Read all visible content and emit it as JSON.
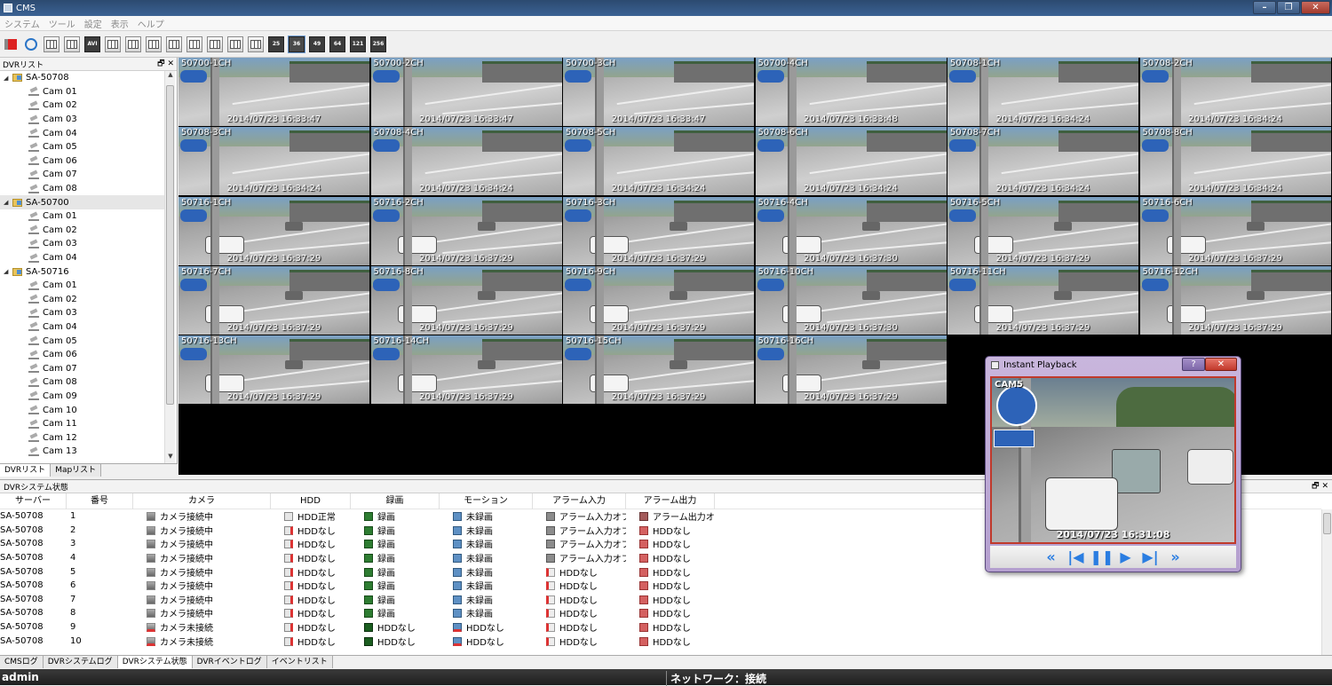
{
  "window": {
    "title": "CMS"
  },
  "menu": [
    "システム",
    "ツール",
    "設定",
    "表示",
    "ヘルプ"
  ],
  "toolbar": {
    "layout_labels": [
      "25",
      "36",
      "49",
      "64",
      "121",
      "256"
    ],
    "avi_label": "AVI"
  },
  "dvr_list": {
    "title": "DVRリスト",
    "groups": [
      {
        "name": "SA-50708",
        "cams": [
          "Cam 01",
          "Cam 02",
          "Cam 03",
          "Cam 04",
          "Cam 05",
          "Cam 06",
          "Cam 07",
          "Cam 08"
        ]
      },
      {
        "name": "SA-50700",
        "cams": [
          "Cam 01",
          "Cam 02",
          "Cam 03",
          "Cam 04"
        ]
      },
      {
        "name": "SA-50716",
        "cams": [
          "Cam 01",
          "Cam 02",
          "Cam 03",
          "Cam 04",
          "Cam 05",
          "Cam 06",
          "Cam 07",
          "Cam 08",
          "Cam 09",
          "Cam 10",
          "Cam 11",
          "Cam 12",
          "Cam 13"
        ]
      }
    ],
    "tabs": [
      "DVRリスト",
      "Mapリスト"
    ]
  },
  "video_cells": [
    {
      "label": "50700-1CH",
      "time": "2014/07/23 16:33:47"
    },
    {
      "label": "50700-2CH",
      "time": "2014/07/23 16:33:47"
    },
    {
      "label": "50700-3CH",
      "time": "2014/07/23 16:33:47"
    },
    {
      "label": "50700-4CH",
      "time": "2014/07/23 16:33:48"
    },
    {
      "label": "50708-1CH",
      "time": "2014/07/23 16:34:24"
    },
    {
      "label": "50708-2CH",
      "time": "2014/07/23 16:34:24"
    },
    {
      "label": "50708-3CH",
      "time": "2014/07/23 16:34:24"
    },
    {
      "label": "50708-4CH",
      "time": "2014/07/23 16:34:24"
    },
    {
      "label": "50708-5CH",
      "time": "2014/07/23 16:34:24"
    },
    {
      "label": "50708-6CH",
      "time": "2014/07/23 16:34:24"
    },
    {
      "label": "50708-7CH",
      "time": "2014/07/23 16:34:24"
    },
    {
      "label": "50708-8CH",
      "time": "2014/07/23 16:34:24"
    },
    {
      "label": "50716-1CH",
      "time": "2014/07/23 16:37:29"
    },
    {
      "label": "50716-2CH",
      "time": "2014/07/23 16:37:29"
    },
    {
      "label": "50716-3CH",
      "time": "2014/07/23 16:37:29"
    },
    {
      "label": "50716-4CH",
      "time": "2014/07/23 16:37:30"
    },
    {
      "label": "50716-5CH",
      "time": "2014/07/23 16:37:29"
    },
    {
      "label": "50716-6CH",
      "time": "2014/07/23 16:37:29"
    },
    {
      "label": "50716-7CH",
      "time": "2014/07/23 16:37:29"
    },
    {
      "label": "50716-8CH",
      "time": "2014/07/23 16:37:29"
    },
    {
      "label": "50716-9CH",
      "time": "2014/07/23 16:37:29"
    },
    {
      "label": "50716-10CH",
      "time": "2014/07/23 16:37:30"
    },
    {
      "label": "50716-11CH",
      "time": "2014/07/23 16:37:29"
    },
    {
      "label": "50716-12CH",
      "time": "2014/07/23 16:37:29"
    },
    {
      "label": "50716-13CH",
      "time": "2014/07/23 16:37:29"
    },
    {
      "label": "50716-14CH",
      "time": "2014/07/23 16:37:29"
    },
    {
      "label": "50716-15CH",
      "time": "2014/07/23 16:37:29"
    },
    {
      "label": "50716-16CH",
      "time": "2014/07/23 16:37:29"
    }
  ],
  "status_panel": {
    "title": "DVRシステム状態",
    "columns": [
      "サーバー",
      "番号",
      "カメラ",
      "HDD",
      "録画",
      "モーション",
      "アラーム入力",
      "アラーム出力"
    ],
    "rows": [
      {
        "server": "SA-50708",
        "no": "1",
        "cam": "カメラ接続中",
        "cam_s": "on",
        "hdd": "HDD正常",
        "hdd_s": "ok",
        "rec": "録画",
        "rec_s": "rec",
        "mot": "未録画",
        "mot_s": "mot",
        "ai": "アラーム入力オフ",
        "ai_s": "off",
        "ao": "アラーム出力オフ",
        "ao_s": "off"
      },
      {
        "server": "SA-50708",
        "no": "2",
        "cam": "カメラ接続中",
        "cam_s": "on",
        "hdd": "HDDなし",
        "hdd_s": "none",
        "rec": "録画",
        "rec_s": "rec",
        "mot": "未録画",
        "mot_s": "mot",
        "ai": "アラーム入力オフ",
        "ai_s": "off",
        "ao": "HDDなし",
        "ao_s": "none"
      },
      {
        "server": "SA-50708",
        "no": "3",
        "cam": "カメラ接続中",
        "cam_s": "on",
        "hdd": "HDDなし",
        "hdd_s": "none",
        "rec": "録画",
        "rec_s": "rec",
        "mot": "未録画",
        "mot_s": "mot",
        "ai": "アラーム入力オフ",
        "ai_s": "off",
        "ao": "HDDなし",
        "ao_s": "none"
      },
      {
        "server": "SA-50708",
        "no": "4",
        "cam": "カメラ接続中",
        "cam_s": "on",
        "hdd": "HDDなし",
        "hdd_s": "none",
        "rec": "録画",
        "rec_s": "rec",
        "mot": "未録画",
        "mot_s": "mot",
        "ai": "アラーム入力オフ",
        "ai_s": "off",
        "ao": "HDDなし",
        "ao_s": "none"
      },
      {
        "server": "SA-50708",
        "no": "5",
        "cam": "カメラ接続中",
        "cam_s": "on",
        "hdd": "HDDなし",
        "hdd_s": "none",
        "rec": "録画",
        "rec_s": "rec",
        "mot": "未録画",
        "mot_s": "mot",
        "ai": "HDDなし",
        "ai_s": "none",
        "ao": "HDDなし",
        "ao_s": "none"
      },
      {
        "server": "SA-50708",
        "no": "6",
        "cam": "カメラ接続中",
        "cam_s": "on",
        "hdd": "HDDなし",
        "hdd_s": "none",
        "rec": "録画",
        "rec_s": "rec",
        "mot": "未録画",
        "mot_s": "mot",
        "ai": "HDDなし",
        "ai_s": "none",
        "ao": "HDDなし",
        "ao_s": "none"
      },
      {
        "server": "SA-50708",
        "no": "7",
        "cam": "カメラ接続中",
        "cam_s": "on",
        "hdd": "HDDなし",
        "hdd_s": "none",
        "rec": "録画",
        "rec_s": "rec",
        "mot": "未録画",
        "mot_s": "mot",
        "ai": "HDDなし",
        "ai_s": "none",
        "ao": "HDDなし",
        "ao_s": "none"
      },
      {
        "server": "SA-50708",
        "no": "8",
        "cam": "カメラ接続中",
        "cam_s": "on",
        "hdd": "HDDなし",
        "hdd_s": "none",
        "rec": "録画",
        "rec_s": "rec",
        "mot": "未録画",
        "mot_s": "mot",
        "ai": "HDDなし",
        "ai_s": "none",
        "ao": "HDDなし",
        "ao_s": "none"
      },
      {
        "server": "SA-50708",
        "no": "9",
        "cam": "カメラ未接続",
        "cam_s": "off",
        "hdd": "HDDなし",
        "hdd_s": "none",
        "rec": "HDDなし",
        "rec_s": "none",
        "mot": "HDDなし",
        "mot_s": "none",
        "ai": "HDDなし",
        "ai_s": "none",
        "ao": "HDDなし",
        "ao_s": "none"
      },
      {
        "server": "SA-50708",
        "no": "10",
        "cam": "カメラ未接続",
        "cam_s": "off",
        "hdd": "HDDなし",
        "hdd_s": "none",
        "rec": "HDDなし",
        "rec_s": "none",
        "mot": "HDDなし",
        "mot_s": "none",
        "ai": "HDDなし",
        "ai_s": "none",
        "ao": "HDDなし",
        "ao_s": "none"
      }
    ]
  },
  "bottom_tabs": [
    "CMSログ",
    "DVRシステムログ",
    "DVRシステム状態",
    "DVRイベントログ",
    "イベントリスト"
  ],
  "statusbar": {
    "user": "admin",
    "network": "ネットワーク：接続"
  },
  "instant_playback": {
    "title": "Instant Playback",
    "help": "?",
    "close": "✕",
    "cam_label": "CAM5",
    "timestamp": "2014/07/23 16:31:08",
    "controls": [
      {
        "name": "fast-rewind-icon",
        "glyph": "«"
      },
      {
        "name": "step-back-icon",
        "glyph": "|◀"
      },
      {
        "name": "pause-icon",
        "glyph": "❚❚"
      },
      {
        "name": "play-icon",
        "glyph": "▶"
      },
      {
        "name": "step-forward-icon",
        "glyph": "▶|"
      },
      {
        "name": "fast-forward-icon",
        "glyph": "»"
      }
    ]
  }
}
